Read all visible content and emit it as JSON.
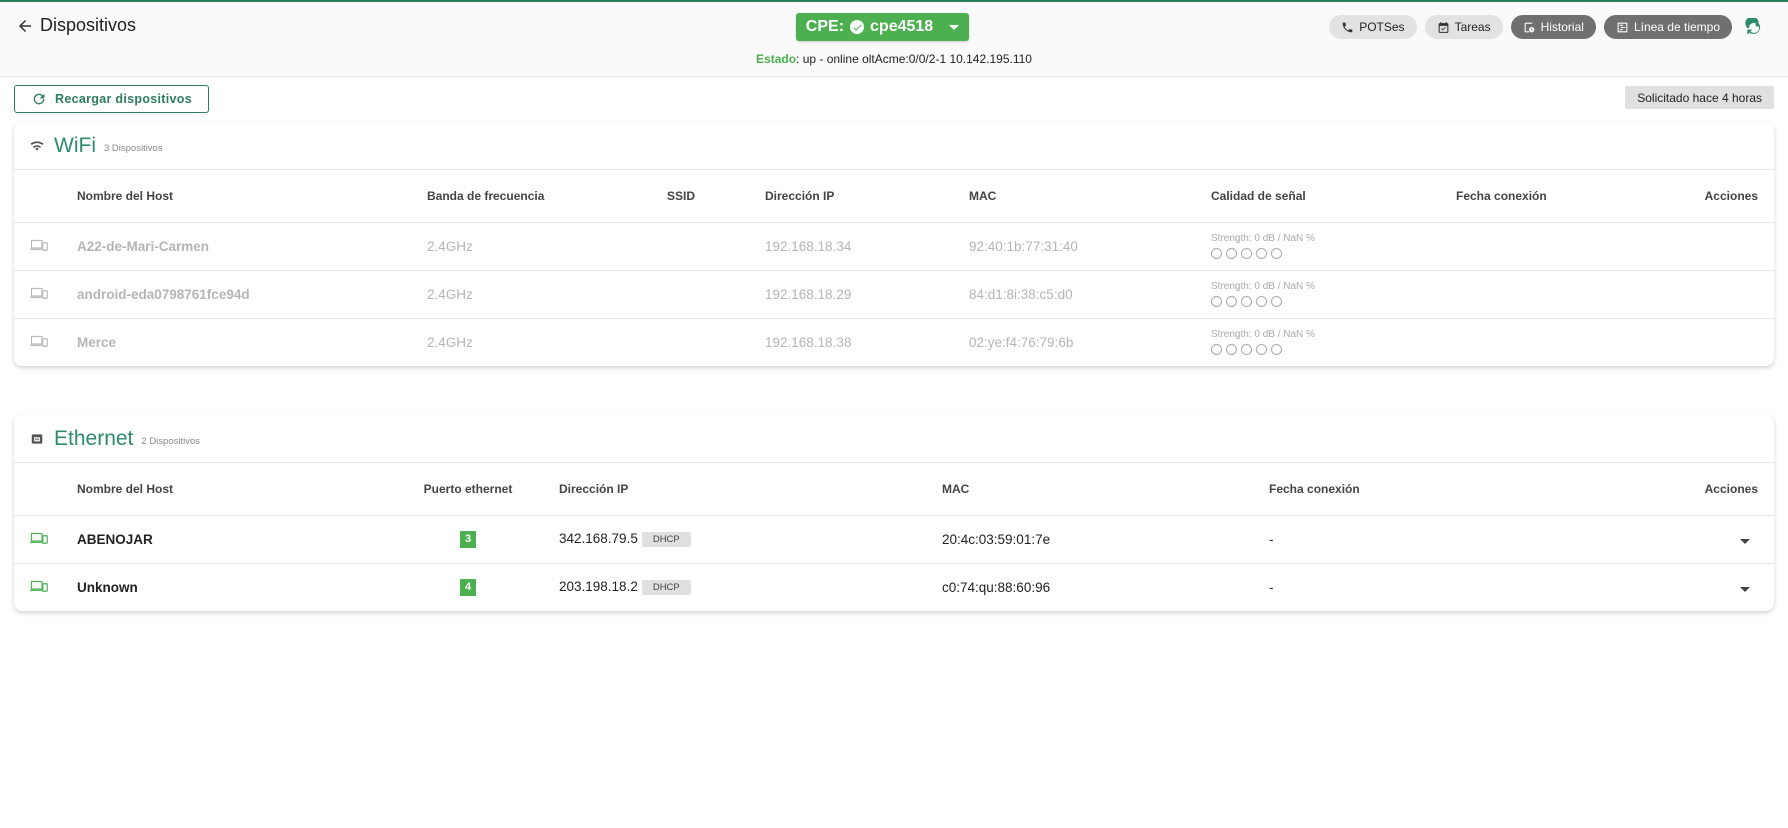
{
  "header": {
    "back_label": "Dispositivos",
    "cpe_label": "CPE:",
    "cpe_name": "cpe4518",
    "status_label": "Estado",
    "status_value": ": up - online oltAcme:0/0/2-1 10.142.195.110",
    "chips": [
      "POTSes",
      "Tareas",
      "Historial",
      "Línea de tiempo"
    ]
  },
  "toolbar": {
    "reload_label": "Recargar dispositivos",
    "requested_label": "Solicitado hace 4 horas"
  },
  "wifi": {
    "title": "WiFi",
    "count": "3 Dispositivos",
    "columns": [
      "Nombre del Host",
      "Banda de frecuencia",
      "SSID",
      "Dirección IP",
      "MAC",
      "Calidad de señal",
      "Fecha conexión",
      "Acciones"
    ],
    "rows": [
      {
        "host": "A22-de-Mari-Carmen",
        "band": "2.4GHz",
        "ssid": "",
        "ip": "192.168.18.34",
        "mac": "92:40:1b:77:31:40",
        "signal": "Strength: 0 dB / NaN %",
        "date": ""
      },
      {
        "host": "android-eda0798761fce94d",
        "band": "2.4GHz",
        "ssid": "",
        "ip": "192.168.18.29",
        "mac": "84:d1:8i:38:c5:d0",
        "signal": "Strength: 0 dB / NaN %",
        "date": ""
      },
      {
        "host": "Merce",
        "band": "2.4GHz",
        "ssid": "",
        "ip": "192.168.18.38",
        "mac": "02:ye:f4:76:79:6b",
        "signal": "Strength: 0 dB / NaN %",
        "date": ""
      }
    ]
  },
  "ethernet": {
    "title": "Ethernet",
    "count": "2 Dispositivos",
    "columns": [
      "Nombre del Host",
      "Puerto ethernet",
      "Dirección IP",
      "MAC",
      "Fecha conexión",
      "Acciones"
    ],
    "rows": [
      {
        "host": "ABENOJAR",
        "port": "3",
        "ip": "342.168.79.5",
        "ip_badge": "DHCP",
        "mac": "20:4c:03:59:01:7e",
        "date": "-"
      },
      {
        "host": "Unknown",
        "port": "4",
        "ip": "203.198.18.2",
        "ip_badge": "DHCP",
        "mac": "c0:74:qu:88:60:96",
        "date": "-"
      }
    ]
  },
  "colors": {
    "accent": "#2e8b6e",
    "success": "#4caf50",
    "chip_dark": "#707070"
  }
}
